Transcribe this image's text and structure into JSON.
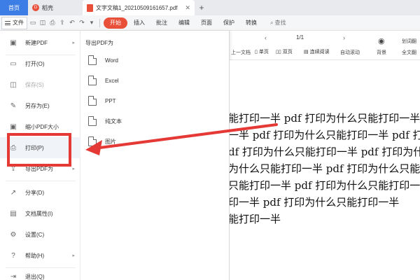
{
  "titlebar": {
    "home_tab": "首页",
    "tabs": [
      {
        "label": "稻壳"
      },
      {
        "label": "文字文稿1_20210509161657.pdf"
      }
    ]
  },
  "menubar": {
    "file_label": "文件",
    "items": [
      "开始",
      "插入",
      "批注",
      "编辑",
      "页面",
      "保护",
      "转换"
    ],
    "active_item": "开始",
    "search_label": "查找"
  },
  "toolbar": {
    "page_indicator": "1/1",
    "labels": {
      "prev_doc": "上一文档",
      "single_page": "单页",
      "double_page": "双页",
      "continuous_read": "连续阅读",
      "auto_scroll": "自动滚动",
      "background": "背景",
      "fullscreen_translate": "全文翻",
      "split_translate": "划词翻"
    }
  },
  "file_menu": {
    "items": [
      {
        "label": "新建PDF",
        "icon": "new-file-icon",
        "has_arrow": true,
        "disabled": false
      },
      {
        "label": "打开(O)",
        "icon": "folder-open-icon",
        "has_arrow": false,
        "disabled": false
      },
      {
        "label": "保存(S)",
        "icon": "save-icon",
        "has_arrow": false,
        "disabled": true
      },
      {
        "label": "另存为(E)",
        "icon": "save-as-icon",
        "has_arrow": false,
        "disabled": false
      },
      {
        "label": "缩小PDF大小",
        "icon": "compress-icon",
        "has_arrow": false,
        "disabled": false
      },
      {
        "label": "打印(P)",
        "icon": "print-icon",
        "has_arrow": false,
        "disabled": false
      },
      {
        "label": "导出PDF为",
        "icon": "export-icon",
        "has_arrow": true,
        "disabled": false
      },
      {
        "label": "分享(D)",
        "icon": "share-icon",
        "has_arrow": false,
        "disabled": false
      },
      {
        "label": "文档属性(I)",
        "icon": "properties-icon",
        "has_arrow": false,
        "disabled": false
      },
      {
        "label": "设置(C)",
        "icon": "settings-icon",
        "has_arrow": false,
        "disabled": false
      },
      {
        "label": "帮助(H)",
        "icon": "help-icon",
        "has_arrow": true,
        "disabled": false
      },
      {
        "label": "退出(Q)",
        "icon": "exit-icon",
        "has_arrow": false,
        "disabled": false
      }
    ]
  },
  "export_panel": {
    "title": "导出PDF为",
    "items": [
      "Word",
      "Excel",
      "PPT",
      "纯文本",
      "图片"
    ]
  },
  "document": {
    "lines": [
      "能打印一半 pdf 打印为什么只能打印一半",
      "一半 pdf 打印为什么只能打印一半 pdf 打印",
      "df 打印为什么只能打印一半 pdf 打印为什",
      "为什么只能打印一半 pdf 打印为什么只能",
      "只能打印一半 pdf 打印为什么只能打印一",
      "印一半 pdf 打印为什么只能打印一半",
      "能打印一半"
    ]
  },
  "colors": {
    "accent": "#3d7ee6",
    "active_menu": "#e8503a",
    "annotation": "#e53935"
  }
}
